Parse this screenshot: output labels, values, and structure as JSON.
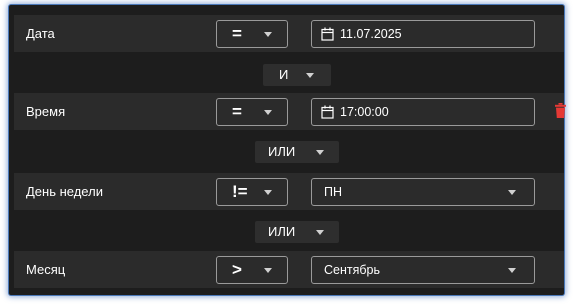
{
  "rows": [
    {
      "label": "Дата",
      "operator": "=",
      "value": "11.07.2025",
      "value_icon": "calendar-icon"
    },
    {
      "label": "Время",
      "operator": "=",
      "value": "17:00:00",
      "value_icon": "calendar-icon",
      "delete_icon": "trash-icon"
    },
    {
      "label": "День недели",
      "operator": "!=",
      "value": "ПН"
    },
    {
      "label": "Месяц",
      "operator": ">",
      "value": "Сентябрь"
    }
  ],
  "connectors": [
    {
      "label": "И"
    },
    {
      "label": "ИЛИ"
    },
    {
      "label": "ИЛИ"
    }
  ],
  "colors": {
    "panel_bg": "#1d1d1d",
    "row_bg": "#2b2b2b",
    "border": "#9a9a9a",
    "delete": "#e53935",
    "panel_glow": "#4a78b8"
  }
}
